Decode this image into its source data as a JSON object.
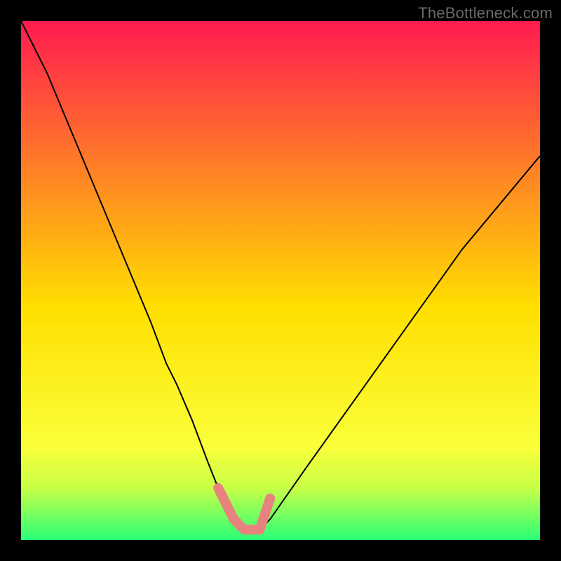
{
  "watermark": "TheBottleneck.com",
  "chart_data": {
    "type": "line",
    "title": "",
    "xlabel": "",
    "ylabel": "",
    "xlim": [
      0,
      100
    ],
    "ylim": [
      0,
      100
    ],
    "legend": false,
    "grid": false,
    "background_gradient": {
      "top_color": "#ff1a4f",
      "mid_color": "#ffe600",
      "bottom_color": "#2bff77"
    },
    "series": [
      {
        "name": "curve",
        "stroke": "#000000",
        "stroke_width": 2,
        "x": [
          0,
          5,
          10,
          15,
          20,
          25,
          28,
          30,
          33,
          36,
          38,
          40,
          41,
          43,
          45,
          46,
          48,
          55,
          60,
          65,
          70,
          75,
          80,
          85,
          90,
          95,
          100
        ],
        "values": [
          100,
          90,
          78,
          66,
          54,
          42,
          34,
          30,
          23,
          15,
          10,
          6,
          4,
          2,
          2,
          2,
          4,
          14,
          21,
          28,
          35,
          42,
          49,
          56,
          62,
          68,
          74
        ]
      },
      {
        "name": "marker-path",
        "stroke": "#e8827e",
        "stroke_width": 14,
        "linecap": "round",
        "x": [
          38,
          40,
          41,
          43,
          45,
          46,
          48
        ],
        "values": [
          10,
          6,
          4,
          2,
          2,
          2,
          8
        ]
      }
    ]
  }
}
